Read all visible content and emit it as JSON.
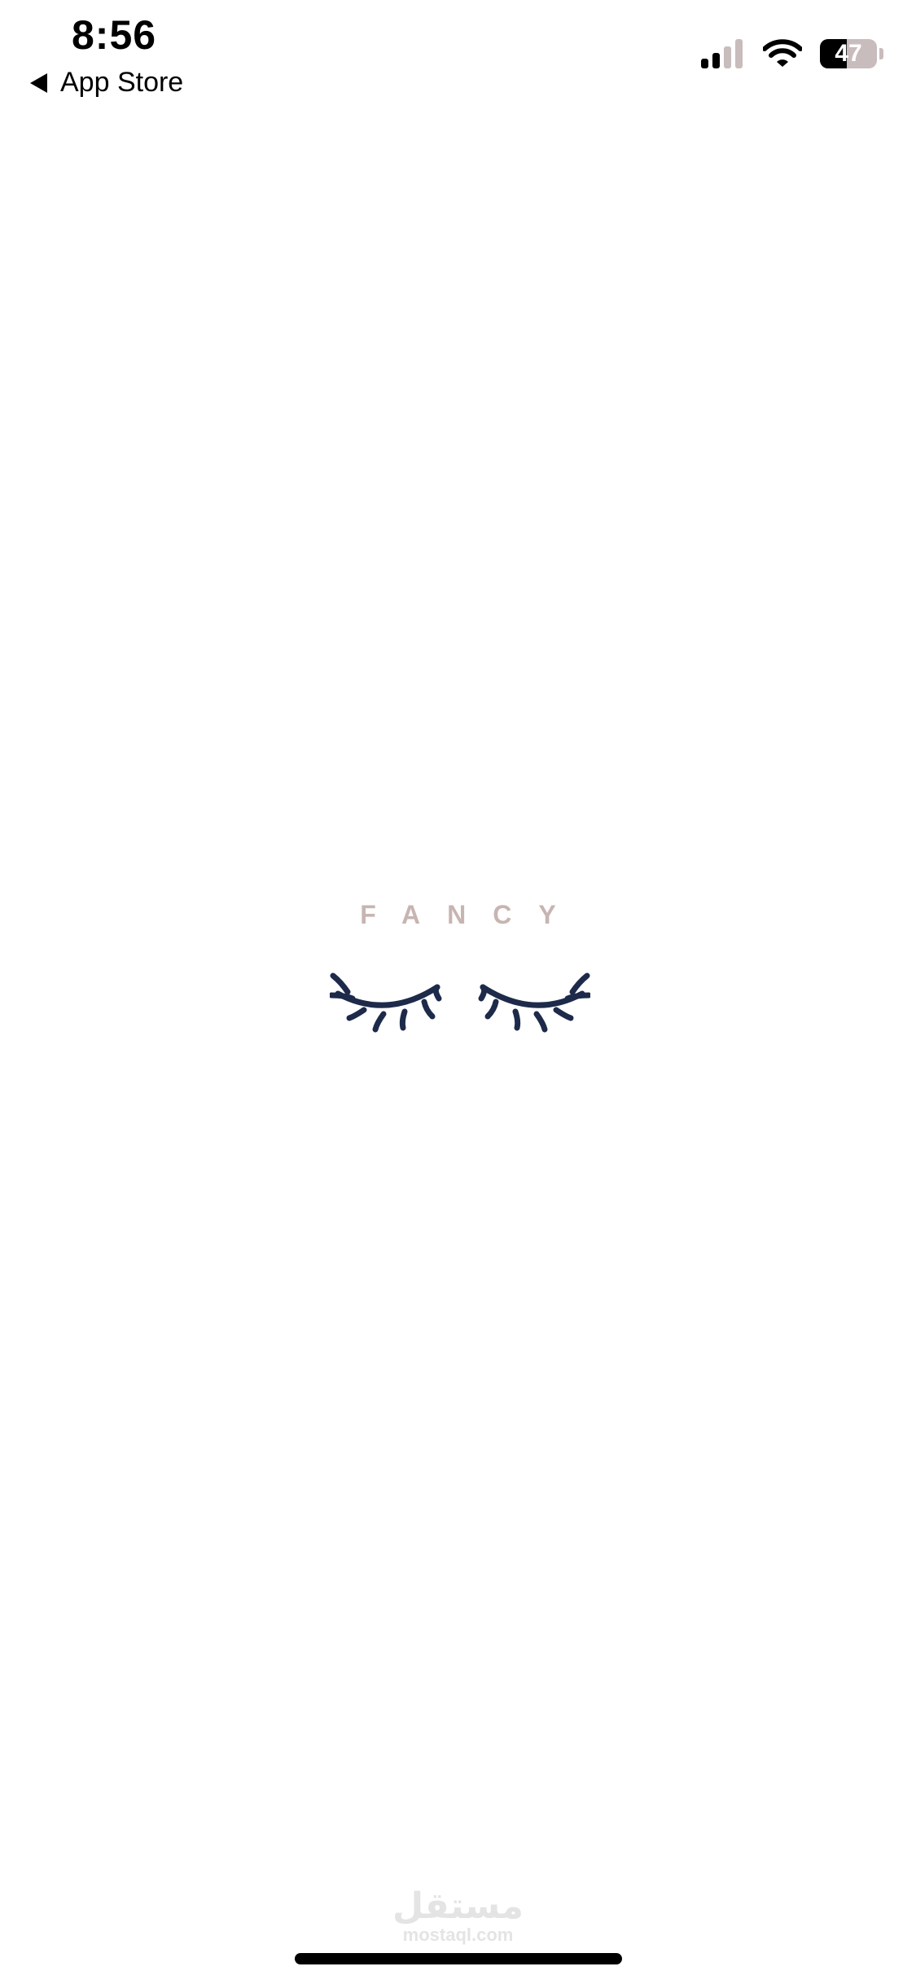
{
  "status_bar": {
    "time": "8:56",
    "back_label": "App Store",
    "battery_level": "47",
    "battery_fraction": 0.47,
    "icons": [
      "back-triangle-icon",
      "cellular-signal-icon",
      "wifi-icon",
      "battery-icon"
    ]
  },
  "brand": {
    "name": "FANCY",
    "name_color": "#c7b5b2",
    "logo_icon": "closed-eyes-lashes-icon",
    "logo_color": "#1e2a4a"
  },
  "watermark": {
    "arabic": "مستقل",
    "domain": "mostaql.com"
  }
}
